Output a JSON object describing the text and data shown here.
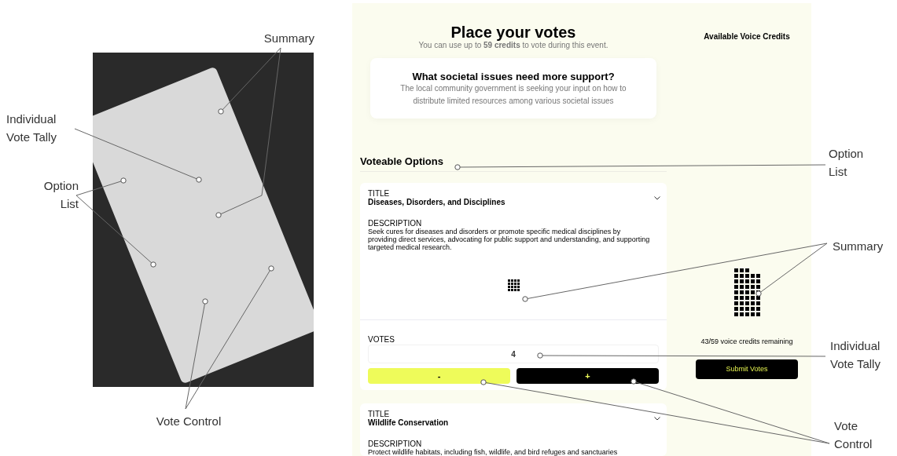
{
  "photo_figure": {
    "annotations": [
      {
        "label": "Summary"
      },
      {
        "label": "Individual Vote Tally"
      },
      {
        "label": "Option List"
      },
      {
        "label": "Vote Control"
      }
    ]
  },
  "voting_page": {
    "heading": "Place your votes",
    "subtitle": "You can use up to **59 credits** to vote during this event.",
    "question": {
      "title": "What societal issues need more support?",
      "description": "The local community government is seeking your input on how to distribute limited resources among various societal issues"
    },
    "options_heading": "Voteable Options",
    "options": [
      {
        "title_label": "TITLE",
        "title": "Diseases, Disorders, and Disciplines",
        "description_label": "DESCRIPTION",
        "description": "Seek cures for diseases and disorders or promote specific medical disciplines by providing direct services, advocating for public support and understanding, and supporting targeted medical research.",
        "votes_label": "VOTES",
        "votes": "4",
        "minus": "-",
        "plus": "+"
      },
      {
        "title_label": "TITLE",
        "title": "Wildlife Conservation",
        "description_label": "DESCRIPTION",
        "description": "Protect wildlife habitats, including fish, wildlife, and bird refuges and sanctuaries"
      }
    ],
    "sidebar": {
      "heading": "Available Voice Credits",
      "credits_remaining": "43/59 voice credits remaining",
      "submit": "Submit Votes"
    }
  },
  "annotations": [
    {
      "label": "Option List"
    },
    {
      "label": "Summary"
    },
    {
      "label": "Individual Vote Tally"
    },
    {
      "label": "Vote Control"
    }
  ]
}
